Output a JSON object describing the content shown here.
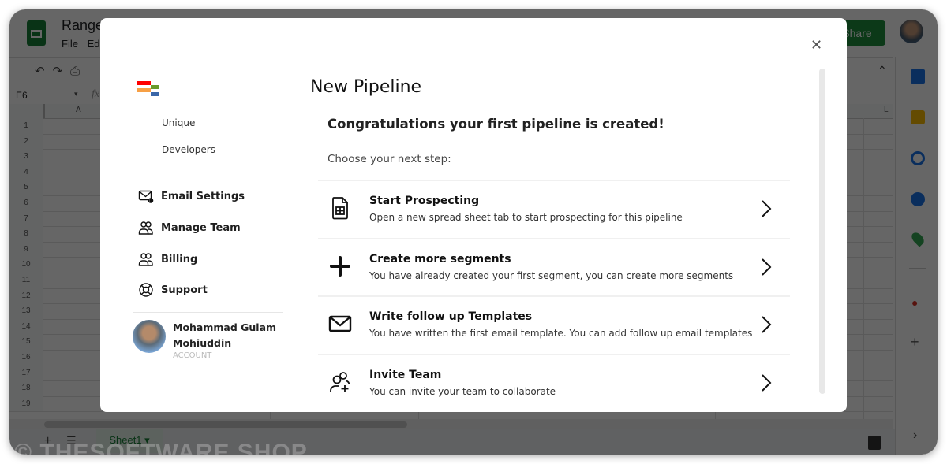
{
  "app": {
    "doc_title": "Range",
    "menu": [
      "File",
      "Ed"
    ],
    "share_label": "Share",
    "name_box": "E6",
    "fx_label": "fx",
    "column_labels": [
      "A",
      "L"
    ],
    "row_numbers": [
      "1",
      "2",
      "3",
      "4",
      "5",
      "6",
      "7",
      "8",
      "9",
      "10",
      "11",
      "12",
      "13",
      "14",
      "15",
      "16",
      "17",
      "18",
      "19"
    ],
    "sheet_tab": "Sheet1 ▾",
    "watermark": "© THESOFTWARE.SHOP"
  },
  "modal": {
    "close_icon": "✕",
    "brand": [
      "Unique",
      "Developers"
    ],
    "nav": [
      {
        "label": "Email Settings",
        "icon": "email-settings-icon"
      },
      {
        "label": "Manage Team",
        "icon": "team-icon"
      },
      {
        "label": "Billing",
        "icon": "billing-icon"
      },
      {
        "label": "Support",
        "icon": "support-icon"
      }
    ],
    "user": {
      "name": "Mohammad Gulam Mohiuddin",
      "role": "ACCOUNT"
    },
    "title": "New Pipeline",
    "subtitle": "Congratulations your first pipeline is created!",
    "prompt": "Choose your next step:",
    "steps": [
      {
        "title": "Start Prospecting",
        "desc": "Open a new spread sheet tab to start prospecting for this pipeline",
        "icon": "spreadsheet-icon"
      },
      {
        "title": "Create more segments",
        "desc": "You have already created your first segment, you can create more segments",
        "icon": "plus-icon"
      },
      {
        "title": "Write follow up Templates",
        "desc": "You have written the first email template. You can add follow up email templates",
        "icon": "envelope-icon"
      },
      {
        "title": "Invite Team",
        "desc": "You can invite your team to collaborate",
        "icon": "invite-user-icon"
      }
    ]
  }
}
